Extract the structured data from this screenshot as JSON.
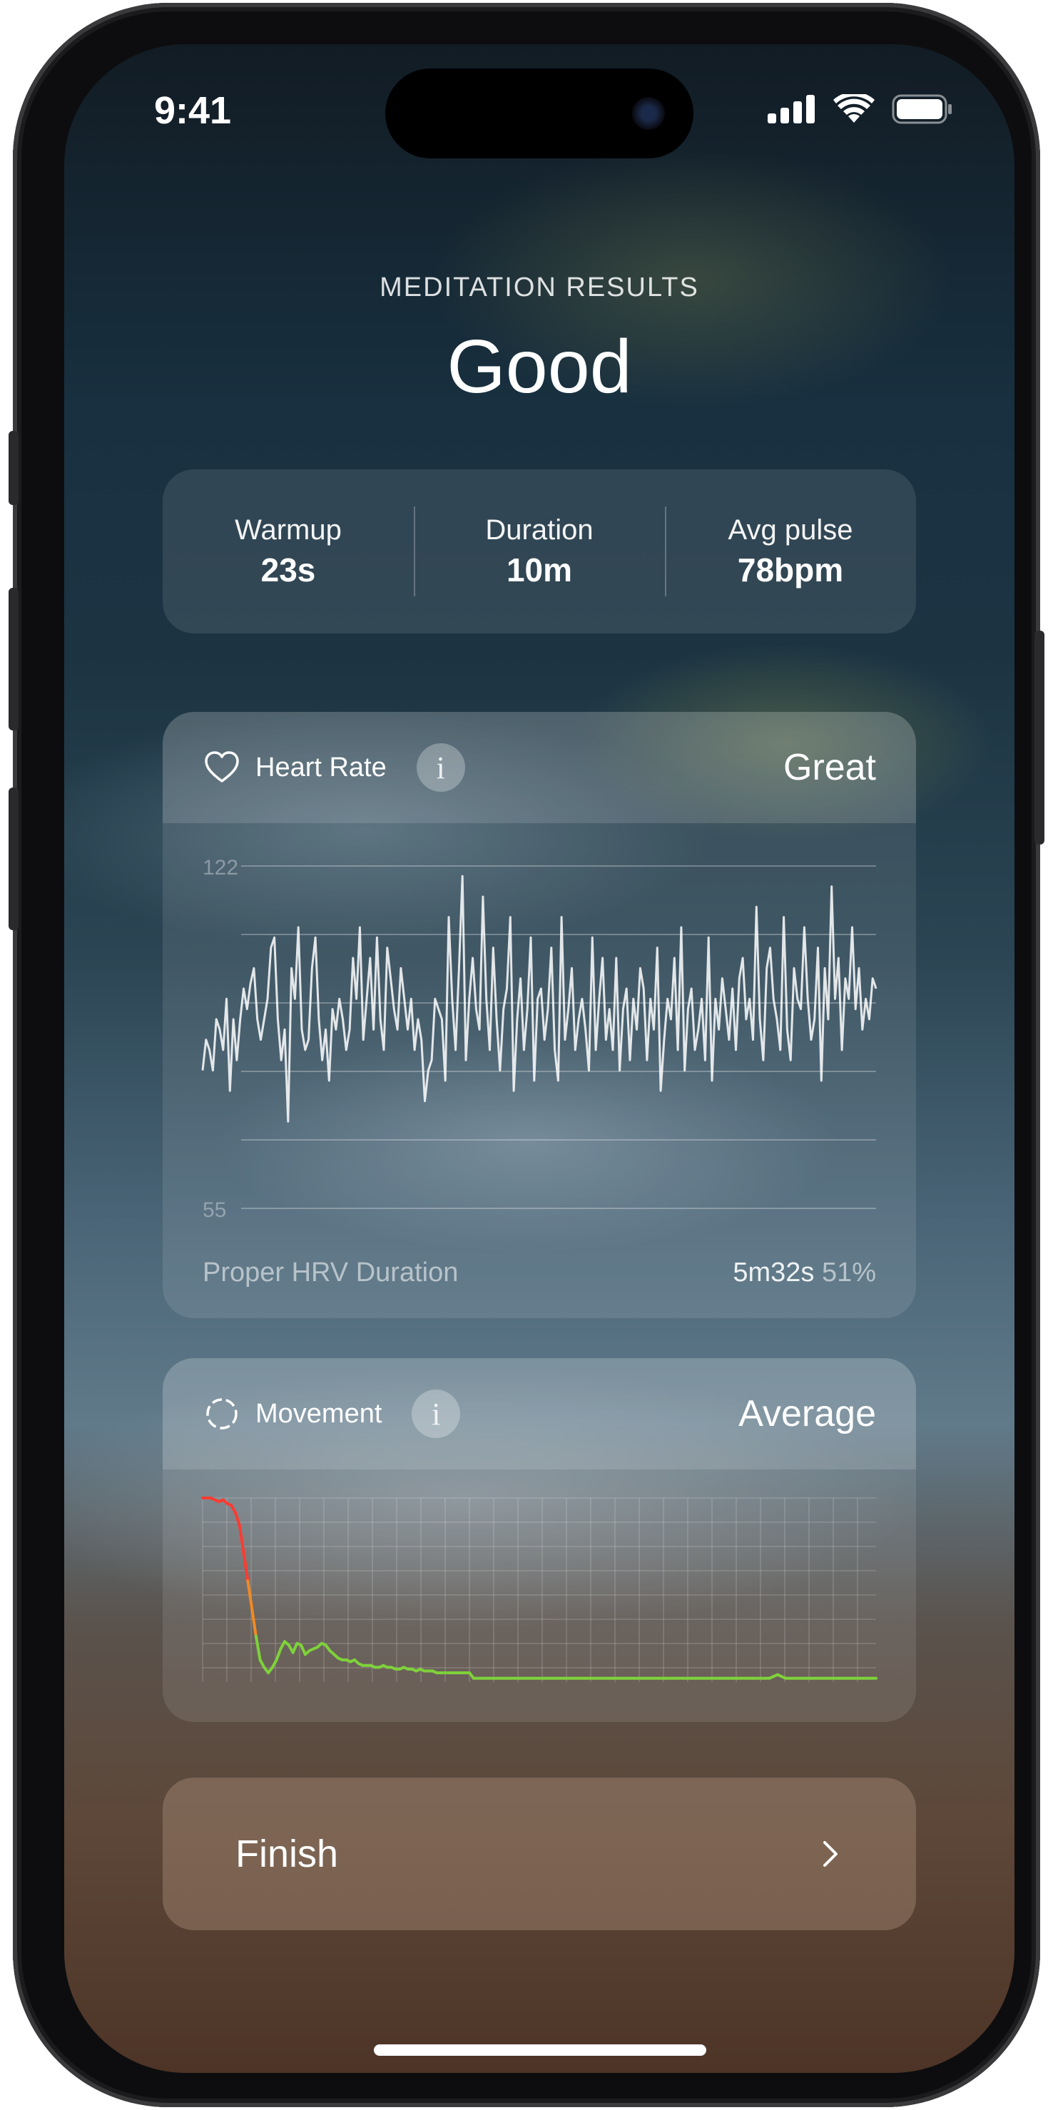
{
  "status_bar": {
    "time": "9:41"
  },
  "header": {
    "label": "MEDITATION RESULTS",
    "result": "Good"
  },
  "stats": [
    {
      "label": "Warmup",
      "value": "23s"
    },
    {
      "label": "Duration",
      "value": "10m"
    },
    {
      "label": "Avg pulse",
      "value": "78bpm"
    }
  ],
  "heart_rate": {
    "label": "Heart Rate",
    "rating": "Great",
    "footer_label": "Proper HRV Duration",
    "footer_duration": "5m32s",
    "footer_percent": "51%",
    "icon": "heart-outline-icon",
    "chart_data": {
      "type": "line",
      "y_max_label": "122",
      "y_min_label": "55",
      "ylim": [
        55,
        122
      ],
      "grid": true,
      "color": "#ffffff",
      "values": [
        82,
        88,
        86,
        82,
        92,
        90,
        86,
        96,
        78,
        92,
        84,
        92,
        98,
        94,
        99,
        102,
        92,
        88,
        92,
        96,
        106,
        108,
        92,
        84,
        90,
        72,
        102,
        96,
        110,
        90,
        86,
        88,
        102,
        108,
        92,
        84,
        90,
        80,
        94,
        90,
        96,
        92,
        86,
        90,
        104,
        96,
        110,
        88,
        96,
        104,
        90,
        108,
        92,
        86,
        106,
        100,
        94,
        90,
        102,
        96,
        90,
        96,
        86,
        92,
        88,
        76,
        82,
        84,
        96,
        94,
        92,
        80,
        112,
        96,
        86,
        102,
        120,
        84,
        96,
        104,
        94,
        90,
        116,
        96,
        86,
        106,
        92,
        82,
        94,
        98,
        112,
        78,
        92,
        100,
        86,
        94,
        108,
        80,
        96,
        98,
        88,
        94,
        106,
        86,
        80,
        112,
        88,
        94,
        102,
        86,
        92,
        96,
        90,
        82,
        108,
        86,
        96,
        104,
        88,
        94,
        86,
        104,
        82,
        94,
        98,
        84,
        96,
        90,
        102,
        98,
        84,
        96,
        90,
        106,
        78,
        88,
        96,
        92,
        104,
        86,
        110,
        82,
        94,
        98,
        86,
        90,
        96,
        84,
        108,
        80,
        96,
        90,
        100,
        94,
        88,
        98,
        86,
        100,
        104,
        92,
        96,
        88,
        114,
        92,
        84,
        102,
        106,
        96,
        92,
        86,
        112,
        90,
        84,
        102,
        96,
        94,
        110,
        96,
        88,
        92,
        106,
        80,
        102,
        92,
        118,
        96,
        104,
        86,
        100,
        96,
        110,
        94,
        102,
        90,
        96,
        92,
        100,
        98
      ]
    }
  },
  "movement": {
    "label": "Movement",
    "rating": "Average",
    "icon": "dashed-circle-icon",
    "chart_data": {
      "type": "line",
      "ylim": [
        0,
        100
      ],
      "grid": true,
      "colors": {
        "high": "#ff3b30",
        "mid": "#f08a24",
        "low": "#7ed23a"
      },
      "values": [
        100,
        100,
        100,
        99,
        98,
        99,
        97,
        96,
        92,
        85,
        70,
        55,
        40,
        25,
        12,
        8,
        5,
        8,
        12,
        18,
        22,
        20,
        16,
        21,
        20,
        15,
        17,
        18,
        19,
        21,
        20,
        17,
        15,
        13,
        12,
        12,
        11,
        12,
        10,
        9,
        9,
        9,
        8,
        8,
        9,
        8,
        8,
        7,
        7,
        8,
        7,
        7,
        6,
        7,
        6,
        6,
        6,
        5,
        5,
        5,
        5,
        5,
        5,
        5,
        5,
        5,
        2,
        2,
        2,
        2,
        2,
        2,
        2,
        2,
        2,
        2,
        2,
        2,
        2,
        2,
        2,
        2,
        2,
        2,
        2,
        2,
        2,
        2,
        2,
        2,
        2,
        2,
        2,
        2,
        2,
        2,
        2,
        2,
        2,
        2,
        2,
        2,
        2,
        2,
        2,
        2,
        2,
        2,
        2,
        2,
        2,
        2,
        2,
        2,
        2,
        2,
        2,
        2,
        2,
        2,
        2,
        2,
        2,
        2,
        2,
        2,
        2,
        2,
        2,
        2,
        2,
        2,
        2,
        2,
        2,
        2,
        2,
        2,
        2,
        3,
        4,
        3,
        2,
        2,
        2,
        2,
        2,
        2,
        2,
        2,
        2,
        2,
        2,
        2,
        2,
        2,
        2,
        2,
        2,
        2,
        2,
        2,
        2,
        2,
        2
      ]
    }
  },
  "finish": {
    "label": "Finish"
  }
}
